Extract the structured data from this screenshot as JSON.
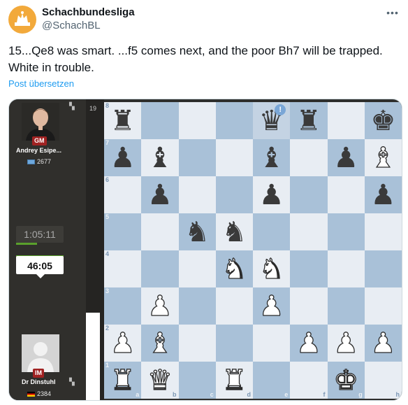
{
  "tweet": {
    "author_name": "Schachbundesliga",
    "author_handle": "@SchachBL",
    "more_icon": "more-horizontal-icon",
    "text": "15...Qe8 was smart. ...f5 comes next, and the poor Bh7 will be trapped. White in trouble.",
    "translate_link": "Post übersetzen"
  },
  "media": {
    "move_number": "19",
    "top_player": {
      "title": "GM",
      "name": "Andrey Esipe...",
      "rating": "2677",
      "clock": "1:05:11"
    },
    "bottom_player": {
      "title": "IM",
      "name": "Dr Dinstuhl",
      "rating": "2384",
      "clock": "46:05"
    },
    "board": {
      "colors": {
        "light": "#e8edf3",
        "dark": "#a9c1d8",
        "highlight": "#93acc6"
      },
      "ranks": [
        "8",
        "7",
        "6",
        "5",
        "4",
        "3",
        "2",
        "1"
      ],
      "files": [
        "a",
        "b",
        "c",
        "d",
        "e",
        "f",
        "g",
        "h"
      ],
      "highlighted": [
        "e8"
      ],
      "alert_square": "e8",
      "alert_text": "!",
      "position": [
        [
          "r",
          "",
          "",
          "",
          "q",
          "r",
          "",
          "k"
        ],
        [
          "p",
          "b",
          "",
          "",
          "b",
          "",
          "p",
          "B"
        ],
        [
          "",
          "p",
          "",
          "",
          "p",
          "",
          "",
          "p"
        ],
        [
          "",
          "",
          "n",
          "n",
          "",
          "",
          "",
          ""
        ],
        [
          "",
          "",
          "",
          "N",
          "N",
          "",
          "",
          ""
        ],
        [
          "",
          "P",
          "",
          "",
          "P",
          "",
          "",
          ""
        ],
        [
          "P",
          "B",
          "",
          "",
          "",
          "P",
          "P",
          "P"
        ],
        [
          "R",
          "Q",
          "",
          "R",
          "",
          "",
          "K",
          ""
        ]
      ]
    }
  }
}
